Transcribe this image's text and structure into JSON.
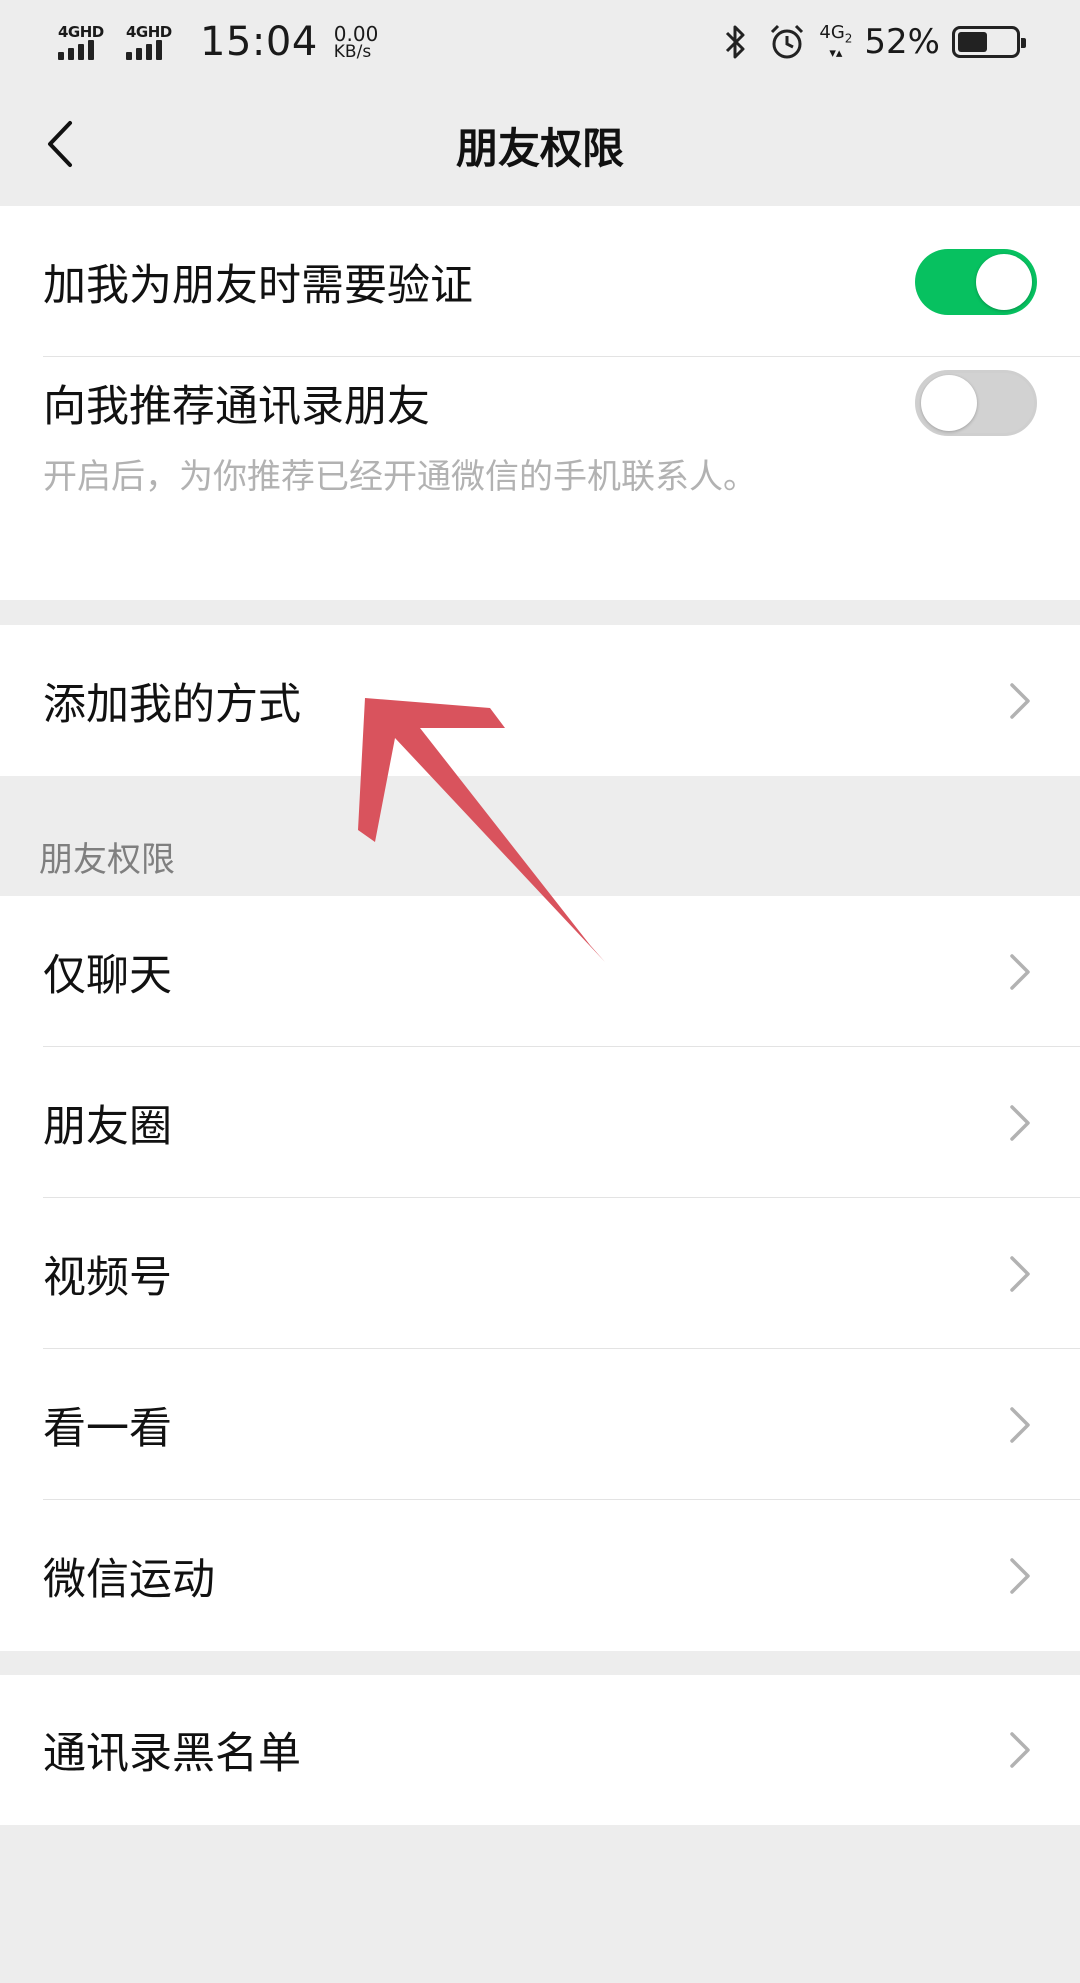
{
  "status_bar": {
    "sim1_label": "4GHD",
    "sim2_label": "4GHD",
    "time": "15:04",
    "net_speed_value": "0.00",
    "net_speed_unit": "KB/s",
    "network_label": "4G",
    "network_sub": "2",
    "battery_percent": "52%",
    "battery_level": 0.52,
    "icons": [
      "bluetooth-icon",
      "alarm-icon"
    ]
  },
  "nav": {
    "title": "朋友权限",
    "back_icon": "chevron-left-icon"
  },
  "group1": {
    "verify": {
      "label": "加我为朋友时需要验证",
      "enabled": true
    },
    "recommend": {
      "label": "向我推荐通讯录朋友",
      "enabled": false,
      "hint": "开启后，为你推荐已经开通微信的手机联系人。"
    }
  },
  "group2": {
    "add_methods": {
      "label": "添加我的方式"
    }
  },
  "section_header": "朋友权限",
  "group3": {
    "items": [
      {
        "label": "仅聊天"
      },
      {
        "label": "朋友圈"
      },
      {
        "label": "视频号"
      },
      {
        "label": "看一看"
      },
      {
        "label": "微信运动"
      }
    ]
  },
  "group4": {
    "blacklist": {
      "label": "通讯录黑名单"
    }
  },
  "colors": {
    "toggle_on": "#07c160",
    "toggle_off": "#d2d2d2",
    "annotation_arrow": "#d9535d",
    "background": "#ededed"
  }
}
